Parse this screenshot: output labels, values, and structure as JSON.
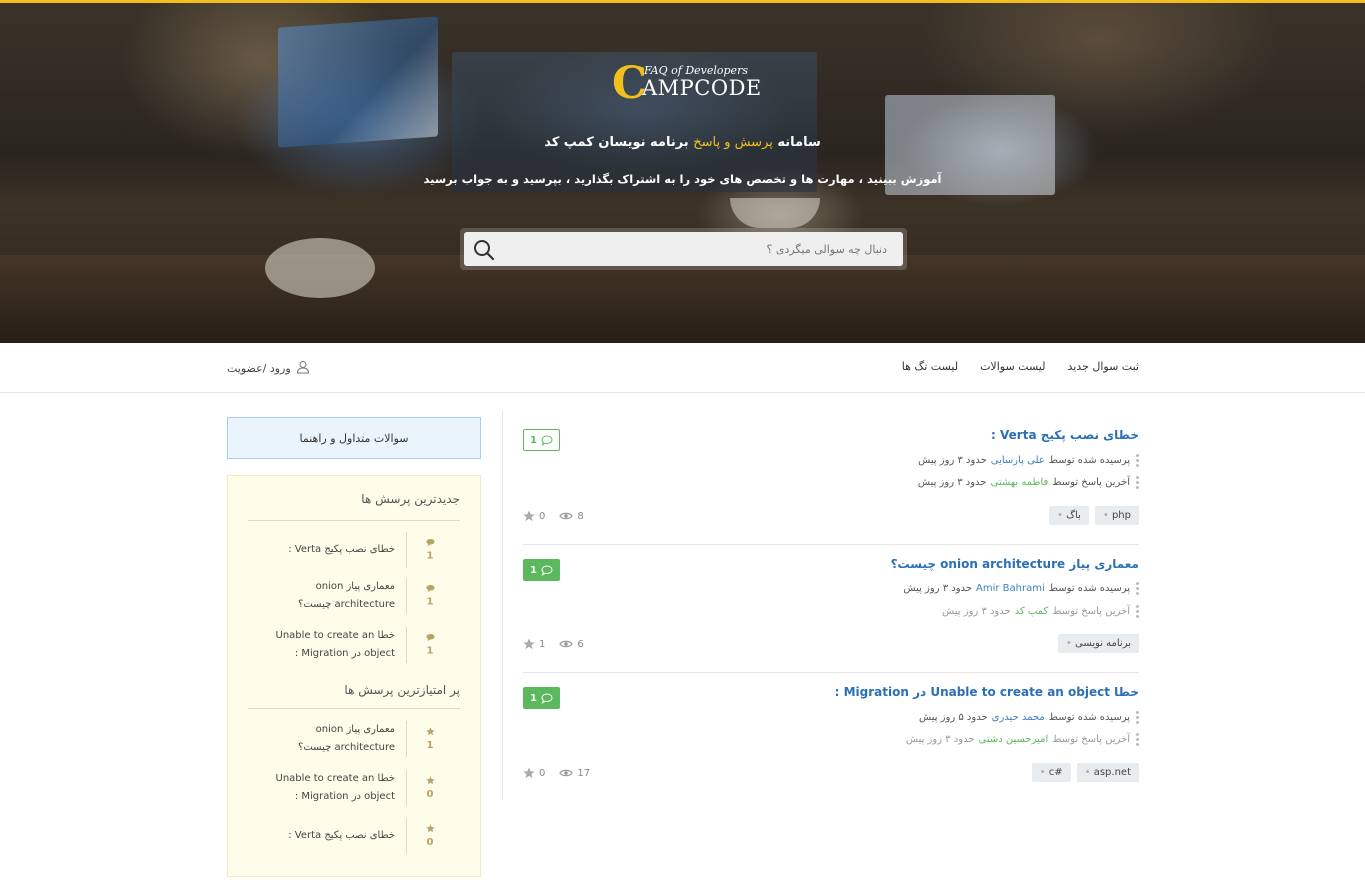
{
  "hero": {
    "logo_letter": "C",
    "logo_tagline": "FAQ of Developers",
    "logo_word": "AMPCODE",
    "title_prefix": "سامانه",
    "title_accent": "پرسش و پاسخ",
    "title_suffix": "برنامه نویسان کمپ کد",
    "subtitle": "آموزش ببینید ، مهارت ها و تخصص های خود را به اشتراک بگذارید ، بپرسید و به جواب برسید",
    "search_placeholder": "دنبال چه سوالی میگردی ؟",
    "accent_color": "#f2c01e"
  },
  "nav": {
    "new_question": "ثبت سوال جدید",
    "question_list": "لیست سوالات",
    "tag_list": "لیست تگ ها",
    "login": "ورود /عضویت"
  },
  "questions": [
    {
      "title": "خطای نصب پکیج Verta :",
      "asked_label": "پرسیده شده توسط",
      "asked_by": "علی پارسایی",
      "asked_time": "حدود ۳ روز پیش",
      "last_label": "آخرین پاسخ توسط",
      "last_by": "فاطمه بهشتی",
      "last_time": "حدود ۳ روز پیش",
      "answers": "1",
      "views": "8",
      "stars": "0",
      "tags": [
        "php",
        "باگ"
      ]
    },
    {
      "title": "معماری پیاز onion architecture چیست؟",
      "asked_label": "پرسیده شده توسط",
      "asked_by": "Amir Bahrami",
      "asked_time": "حدود ۳ روز پیش",
      "last_label": "آخرین پاسخ توسط",
      "last_by": "کمپ کد",
      "last_time": "حدود ۳ روز پیش",
      "answers": "1",
      "views": "6",
      "stars": "1",
      "tags": [
        "برنامه نویسی"
      ]
    },
    {
      "title": "خطا Unable to create an object در Migration :",
      "asked_label": "پرسیده شده توسط",
      "asked_by": "محمد حیدری",
      "asked_time": "حدود ۵ روز پیش",
      "last_label": "آخرین پاسخ توسط",
      "last_by": "امیرحسین دشتی",
      "last_time": "حدود ۳ روز پیش",
      "answers": "1",
      "views": "17",
      "stars": "0",
      "tags": [
        "asp.net",
        "c#"
      ]
    }
  ],
  "sidebar": {
    "faq_button": "سوالات متداول و راهنما",
    "latest_heading": "جدیدترین پرسش ها",
    "latest": [
      {
        "text": "خطای نصب پکیج Verta :",
        "count": "1"
      },
      {
        "text": "معماری پیاز onion architecture چیست؟",
        "count": "1"
      },
      {
        "text": "خطا Unable to create an object در Migration :",
        "count": "1"
      }
    ],
    "top_heading": "پر امتیازترین پرسش ها",
    "top": [
      {
        "text": "معماری پیاز onion architecture چیست؟",
        "count": "1"
      },
      {
        "text": "خطا Unable to create an object در Migration :",
        "count": "0"
      },
      {
        "text": "خطای نصب پکیج Verta :",
        "count": "0"
      }
    ]
  }
}
